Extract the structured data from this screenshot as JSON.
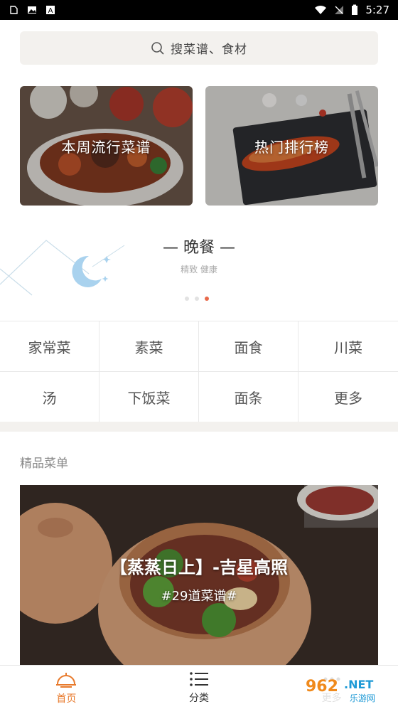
{
  "status_bar": {
    "time": "5:27"
  },
  "search": {
    "placeholder": "搜菜谱、食材"
  },
  "banners": [
    {
      "label": "本周流行菜谱"
    },
    {
      "label": "热门排行榜"
    }
  ],
  "meal": {
    "title": "— 晚餐 —",
    "subtitle": "精致 健康",
    "carousel": {
      "total": 3,
      "active_index": 2
    }
  },
  "categories": [
    "家常菜",
    "素菜",
    "面食",
    "川菜",
    "汤",
    "下饭菜",
    "面条",
    "更多"
  ],
  "featured": {
    "section_title": "精品菜单",
    "title": "【蒸蒸日上】-吉星高照",
    "subtitle": "#29道菜谱#"
  },
  "bottom_nav": [
    {
      "label": "首页",
      "icon": "home-icon",
      "active": true
    },
    {
      "label": "分类",
      "icon": "list-icon",
      "active": false
    },
    {
      "label": "更多",
      "icon": "more-icon",
      "active": false
    }
  ],
  "watermark": {
    "text": "962.NET",
    "subtext": "乐游网"
  },
  "colors": {
    "accent": "#e87a2c",
    "dot_active": "#e8694a",
    "search_bg": "#f3f1ee"
  }
}
